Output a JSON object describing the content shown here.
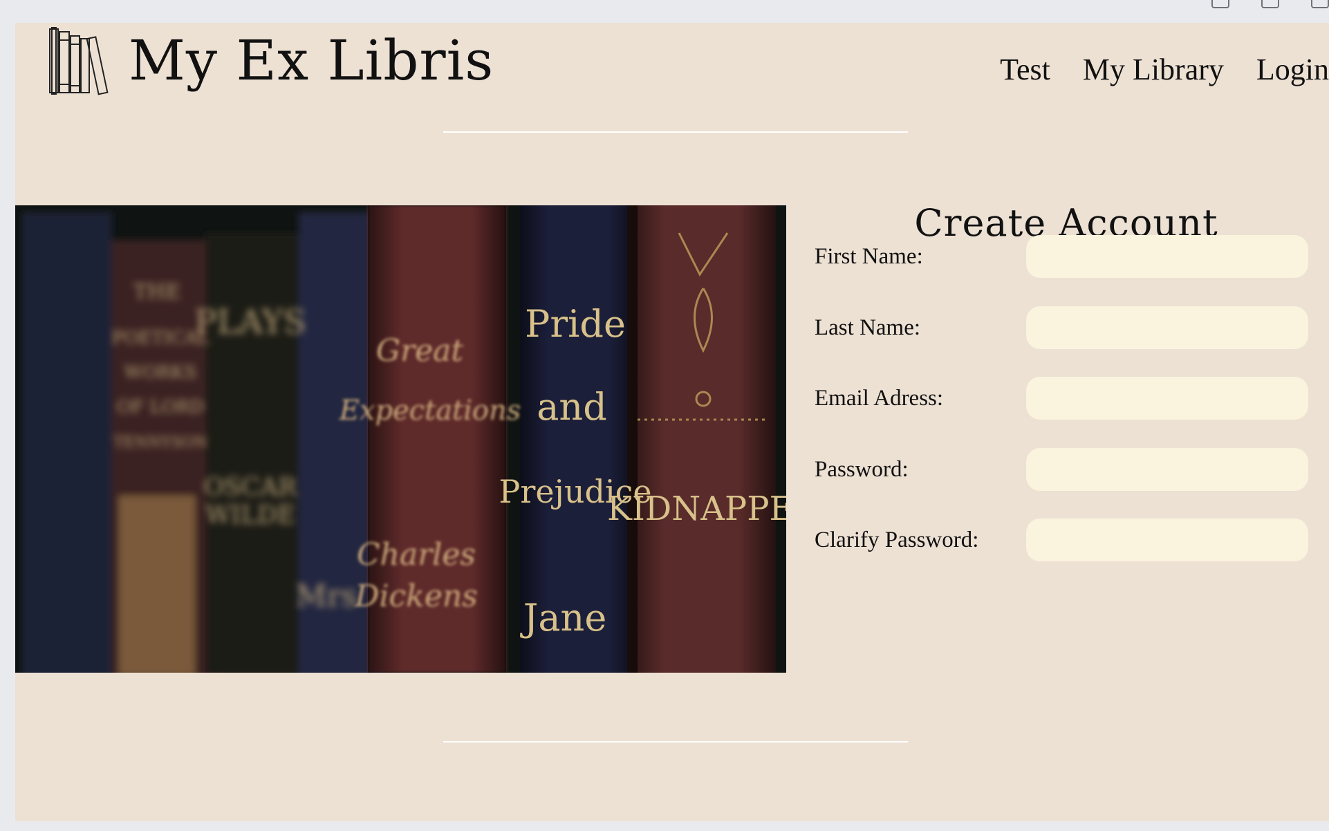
{
  "brand": {
    "title": "My Ex Libris",
    "logo_icon": "books-icon"
  },
  "nav": {
    "items": [
      "Test",
      "My Library",
      "Login"
    ]
  },
  "hero": {
    "spine_texts": [
      "Pride",
      "and",
      "Prejudice",
      "Jane",
      "KIDNAPPED",
      "Great",
      "Expectations",
      "Charles",
      "Dickens",
      "Mrs",
      "PLAYS",
      "OSCAR",
      "WILDE",
      "THE",
      "POETICAL",
      "WORKS",
      "OF LORD",
      "TENNYSON"
    ]
  },
  "form": {
    "title": "Create Account",
    "fields": [
      {
        "label": "First Name:",
        "value": ""
      },
      {
        "label": "Last Name:",
        "value": ""
      },
      {
        "label": "Email Adress:",
        "value": ""
      },
      {
        "label": "Password:",
        "value": ""
      },
      {
        "label": "Clarify Password:",
        "value": ""
      }
    ]
  },
  "colors": {
    "page_bg": "#ede1d4",
    "input_bg": "#faf3dd",
    "outer_bg": "#e9eaee",
    "text": "#111111"
  }
}
